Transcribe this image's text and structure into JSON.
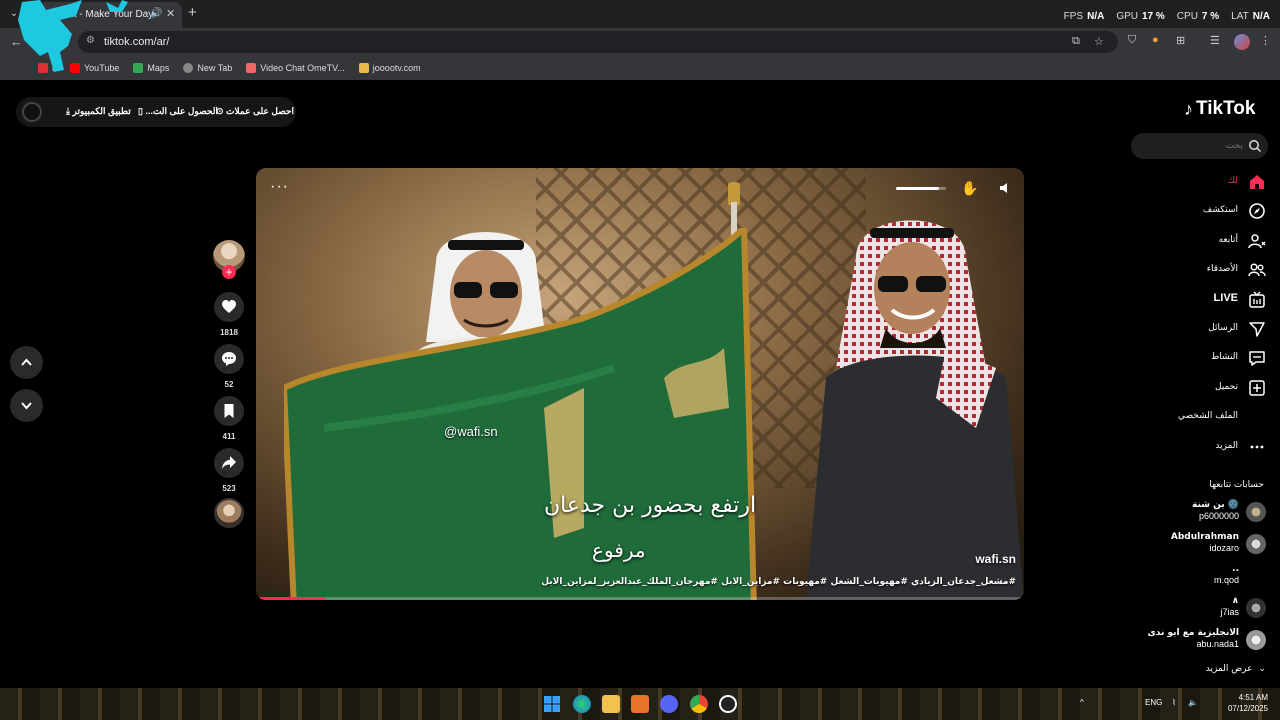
{
  "browser": {
    "tab_title": "TikTok - Make Your Day",
    "url": "tiktok.com/ar/",
    "stats": [
      {
        "label": "FPS",
        "value": "N/A"
      },
      {
        "label": "GPU",
        "value": "17 %"
      },
      {
        "label": "CPU",
        "value": "7 %"
      },
      {
        "label": "LAT",
        "value": "N/A"
      }
    ],
    "bookmarks": [
      {
        "label": "il",
        "color": "#d33"
      },
      {
        "label": "YouTube",
        "color": "#f00"
      },
      {
        "label": "Maps",
        "color": "#34a853"
      },
      {
        "label": "New Tab",
        "color": "#888"
      },
      {
        "label": "Video Chat OmeTV...",
        "color": "#e66"
      },
      {
        "label": "jooootv.com",
        "color": "#e8b84a"
      }
    ]
  },
  "topbar": {
    "get_coins": "احصل على عملات",
    "get_app": "الحصول على الت...",
    "desktop_app": "تطبيق الكمبيوتر"
  },
  "logo": {
    "text": "TikTok"
  },
  "search": {
    "placeholder": "بحث"
  },
  "menu": [
    {
      "label": "لك",
      "icon": "home-icon",
      "active": true
    },
    {
      "label": "استكشف",
      "icon": "compass-icon"
    },
    {
      "label": "أتابعه",
      "icon": "follow-user-icon"
    },
    {
      "label": "الأصدقاء",
      "icon": "friends-icon"
    },
    {
      "label": "LIVE",
      "icon": "live-icon"
    },
    {
      "label": "الرسائل",
      "icon": "send-icon"
    },
    {
      "label": "النشاط",
      "icon": "activity-icon"
    },
    {
      "label": "تحميل",
      "icon": "upload-icon"
    },
    {
      "label": "الملف الشخصي",
      "icon": "profile-icon"
    },
    {
      "label": "المزيد",
      "icon": "more-icon"
    }
  ],
  "following": {
    "title": "حسابات تتابعها",
    "accounts": [
      {
        "name": "بن شنة 🌚",
        "handle": "p6000000"
      },
      {
        "name": "Abdulrahman",
        "handle": "idozaro"
      },
      {
        "name": "..",
        "handle": "m.qod"
      },
      {
        "name": "∧",
        "handle": "j7ias"
      },
      {
        "name": "الانجليزية مع ابو ندى",
        "handle": "abu.nada1"
      }
    ],
    "see_more": "عرض المزيد"
  },
  "video": {
    "watermark": "@wafi.sn",
    "caption_line1": "ارتفع بحضور بن جدعان",
    "caption_line2": "مرفوع",
    "author": "wafi.sn",
    "hashtags": "#مشعل_جدعان_الزيادي #مهيوبات_الشعل #مهيوبات #مزاين_الابل #مهرجان_الملك_عبدالعزيز_لمزاين_الابل",
    "more": "···",
    "progress": 0.09,
    "volume": 0.85
  },
  "actions": {
    "likes": "1818",
    "comments": "52",
    "saves": "411",
    "shares": "523"
  },
  "taskbar": {
    "language": "ENG",
    "time": "4:51 AM",
    "date": "07/12/2025"
  }
}
